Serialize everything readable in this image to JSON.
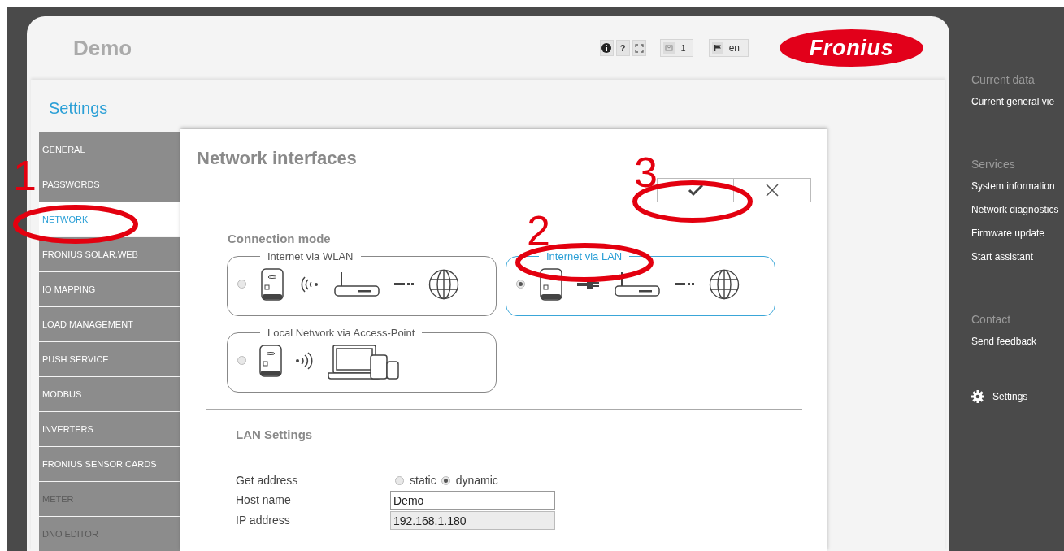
{
  "header": {
    "title": "Demo",
    "help_label": "?",
    "messages_count": "1",
    "language": "en",
    "logo": "Fronius"
  },
  "settings": {
    "title": "Settings",
    "menu": [
      {
        "label": "GENERAL",
        "selected": false,
        "disabled": false
      },
      {
        "label": "PASSWORDS",
        "selected": false,
        "disabled": false
      },
      {
        "label": "NETWORK",
        "selected": true,
        "disabled": false
      },
      {
        "label": "FRONIUS SOLAR.WEB",
        "selected": false,
        "disabled": false
      },
      {
        "label": "IO MAPPING",
        "selected": false,
        "disabled": false
      },
      {
        "label": "LOAD MANAGEMENT",
        "selected": false,
        "disabled": false
      },
      {
        "label": "PUSH SERVICE",
        "selected": false,
        "disabled": false
      },
      {
        "label": "MODBUS",
        "selected": false,
        "disabled": false
      },
      {
        "label": "INVERTERS",
        "selected": false,
        "disabled": false
      },
      {
        "label": "FRONIUS SENSOR CARDS",
        "selected": false,
        "disabled": false
      },
      {
        "label": "METER",
        "selected": false,
        "disabled": true
      },
      {
        "label": "DNO EDITOR",
        "selected": false,
        "disabled": true
      }
    ]
  },
  "content": {
    "title": "Network interfaces",
    "connection_mode": {
      "title": "Connection mode",
      "options": [
        {
          "label": "Internet via WLAN",
          "kind": "wlan",
          "selected": false
        },
        {
          "label": "Internet via LAN",
          "kind": "lan",
          "selected": true
        },
        {
          "label": "Local Network via Access-Point",
          "kind": "accesspoint",
          "selected": false
        }
      ]
    },
    "lan_settings": {
      "title": "LAN Settings",
      "get_address": {
        "label": "Get address",
        "choices": [
          {
            "label": "static",
            "selected": false
          },
          {
            "label": "dynamic",
            "selected": true
          }
        ]
      },
      "fields": [
        {
          "label": "Host name",
          "value": "Demo",
          "disabled": false
        },
        {
          "label": "IP address",
          "value": "192.168.1.180",
          "disabled": true
        }
      ]
    }
  },
  "right_menu": [
    {
      "heading": "Current data",
      "links": [
        "Current general vie"
      ]
    },
    {
      "heading": "Services",
      "links": [
        "System information",
        "Network diagnostics",
        "Firmware update",
        "Start assistant"
      ]
    },
    {
      "heading": "Contact",
      "links": [
        "Send feedback"
      ]
    }
  ],
  "right_settings": "Settings",
  "annotations": [
    {
      "label": "1"
    },
    {
      "label": "2"
    },
    {
      "label": "3"
    }
  ]
}
